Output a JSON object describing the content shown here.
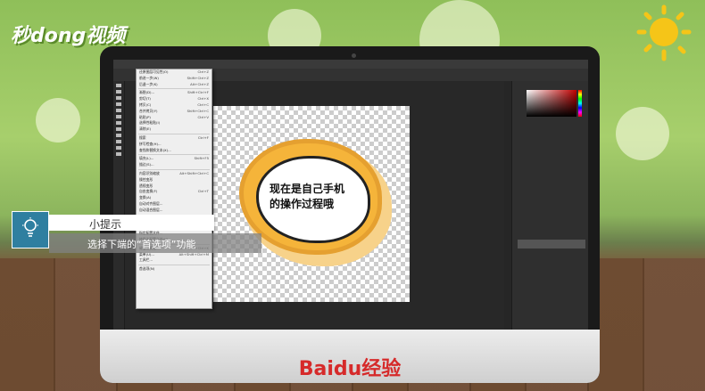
{
  "brand": {
    "logo_text": "秒dong视频",
    "footer_logo": "Baidu经验"
  },
  "tip": {
    "title": "小提示",
    "body": "选择下端的“首选项”功能"
  },
  "cloud": {
    "line1": "现在是自己手机",
    "line2": "的操作过程哦"
  },
  "ps": {
    "menubar": [
      "文件(F)",
      "编辑(E)",
      "图像(I)",
      "图层(L)",
      "文字(Y)",
      "选择(S)",
      "滤镜(T)",
      "3D(D)",
      "视图(V)",
      "窗口(W)",
      "帮助(H)"
    ],
    "edit_menu": [
      {
        "label": "还原图层可见性(O)",
        "key": "Ctrl+Z"
      },
      {
        "label": "前进一步(W)",
        "key": "Shift+Ctrl+Z"
      },
      {
        "label": "后退一步(K)",
        "key": "Alt+Ctrl+Z"
      },
      {
        "label": "渐隐(D)...",
        "key": "Shift+Ctrl+F"
      },
      {
        "label": "剪切(T)",
        "key": "Ctrl+X"
      },
      {
        "label": "拷贝(C)",
        "key": "Ctrl+C"
      },
      {
        "label": "合并拷贝(Y)",
        "key": "Shift+Ctrl+C"
      },
      {
        "label": "粘贴(P)",
        "key": "Ctrl+V"
      },
      {
        "label": "选择性粘贴(I)",
        "key": ""
      },
      {
        "label": "清除(E)",
        "key": ""
      },
      {
        "label": "搜索",
        "key": "Ctrl+F"
      },
      {
        "label": "拼写检查(H)...",
        "key": ""
      },
      {
        "label": "查找和替换文本(X)...",
        "key": ""
      },
      {
        "label": "填充(L)...",
        "key": "Shift+F5"
      },
      {
        "label": "描边(S)...",
        "key": ""
      },
      {
        "label": "内容识别缩放",
        "key": "Alt+Shift+Ctrl+C"
      },
      {
        "label": "操控变形",
        "key": ""
      },
      {
        "label": "透视变形",
        "key": ""
      },
      {
        "label": "自由变换(F)",
        "key": "Ctrl+T"
      },
      {
        "label": "变换(A)",
        "key": ""
      },
      {
        "label": "自动对齐图层...",
        "key": ""
      },
      {
        "label": "自动混合图层...",
        "key": ""
      },
      {
        "label": "远程连接...",
        "key": ""
      },
      {
        "label": "颜色设置(G)...",
        "key": "Shift+Ctrl+K"
      },
      {
        "label": "指定配置文件...",
        "key": ""
      },
      {
        "label": "转换为配置文件(V)...",
        "key": ""
      },
      {
        "label": "键盘快捷键...",
        "key": "Alt+Shift+Ctrl+K"
      },
      {
        "label": "菜单(U)...",
        "key": "Alt+Shift+Ctrl+M"
      },
      {
        "label": "工具栏...",
        "key": ""
      },
      {
        "label": "首选项(N)",
        "key": ""
      }
    ]
  },
  "colors": {
    "tip_blue": "#2f7fa0",
    "baidu_red": "#d62a2a",
    "cloud_orange": "#f5b43a"
  }
}
